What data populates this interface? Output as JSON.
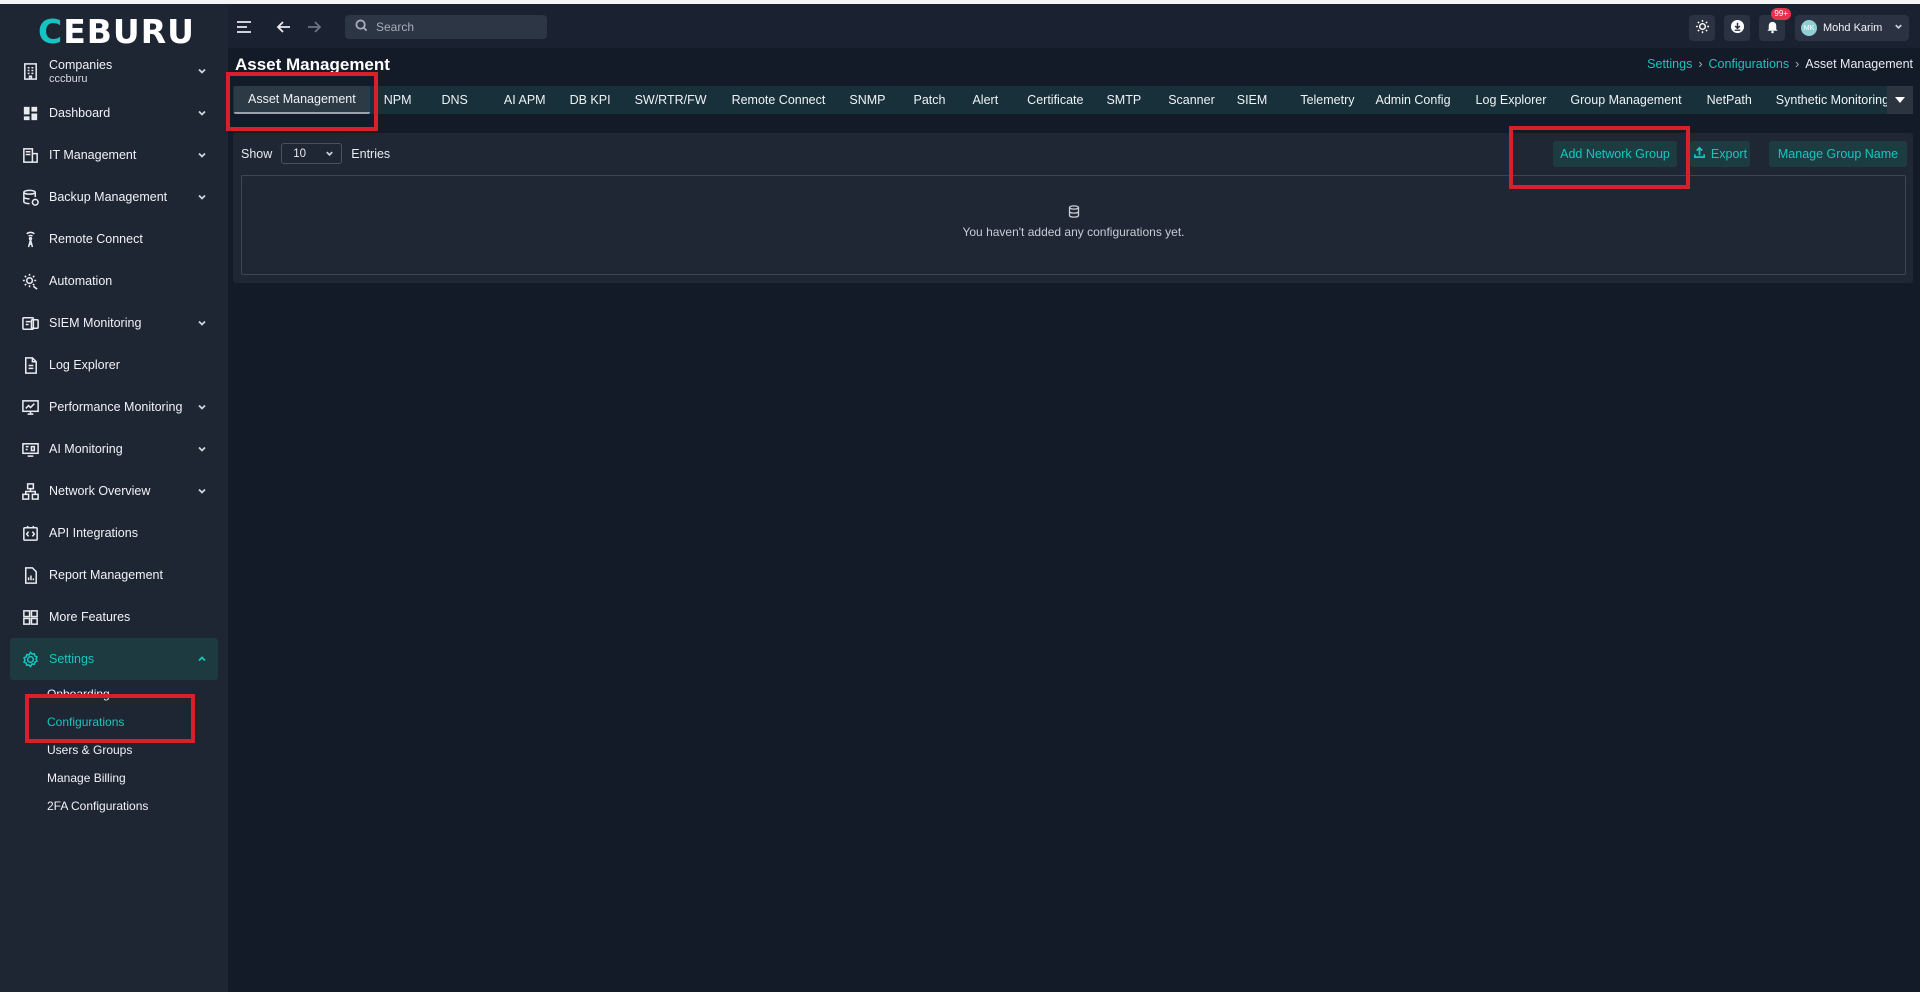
{
  "app": {
    "logo_text_accent": "C",
    "logo_text": "EBURU"
  },
  "sidebar": {
    "items": [
      {
        "label": "Companies",
        "sub": "cccburu",
        "icon": "building-icon",
        "has_chevron": true
      },
      {
        "label": "Dashboard",
        "icon": "dashboard-icon",
        "has_chevron": true
      },
      {
        "label": "IT Management",
        "icon": "server-icon",
        "has_chevron": true
      },
      {
        "label": "Backup Management",
        "icon": "database-backup-icon",
        "has_chevron": true
      },
      {
        "label": "Remote Connect",
        "icon": "antenna-icon",
        "has_chevron": false
      },
      {
        "label": "Automation",
        "icon": "gear-automation-icon",
        "has_chevron": false
      },
      {
        "label": "SIEM Monitoring",
        "icon": "siem-icon",
        "has_chevron": true
      },
      {
        "label": "Log Explorer",
        "icon": "file-icon",
        "has_chevron": false
      },
      {
        "label": "Performance Monitoring",
        "icon": "monitor-chart-icon",
        "has_chevron": true
      },
      {
        "label": "AI Monitoring",
        "icon": "ai-monitor-icon",
        "has_chevron": true
      },
      {
        "label": "Network Overview",
        "icon": "network-icon",
        "has_chevron": true
      },
      {
        "label": "API Integrations",
        "icon": "api-icon",
        "has_chevron": false
      },
      {
        "label": "Report Management",
        "icon": "report-icon",
        "has_chevron": false
      },
      {
        "label": "More Features",
        "icon": "grid-icon",
        "has_chevron": false
      },
      {
        "label": "Settings",
        "icon": "settings-icon",
        "has_chevron": true
      }
    ],
    "settings_sub": [
      "Onboarding",
      "Configurations",
      "Users & Groups",
      "Manage Billing",
      "2FA Configurations"
    ],
    "active_sub": "Configurations"
  },
  "topbar": {
    "search_placeholder": "Search",
    "notification_badge": "99+",
    "user_initials": "MK",
    "user_name": "Mohd Karim"
  },
  "page": {
    "title": "Asset Management",
    "breadcrumb": [
      "Settings",
      "Configurations",
      "Asset Management"
    ]
  },
  "tabs": [
    "Asset Management",
    "NPM",
    "DNS",
    "AI APM",
    "DB KPI",
    "SW/RTR/FW",
    "Remote Connect",
    "SNMP",
    "Patch",
    "Alert",
    "Certificate",
    "SMTP",
    "Scanner",
    "SIEM",
    "Telemetry",
    "Admin Config",
    "Log Explorer",
    "Group Management",
    "NetPath",
    "Synthetic Monitoring"
  ],
  "toolbar": {
    "show_label": "Show",
    "page_size": "10",
    "entries_label": "Entries",
    "add_label": "Add Network Group",
    "export_label": "Export",
    "manage_label": "Manage Group Name"
  },
  "empty_state": {
    "message": "You haven't added any configurations yet."
  },
  "colors": {
    "accent": "#19c5bd",
    "highlight": "#d72029",
    "background": "#131a28",
    "sidebar": "#1f2633"
  }
}
